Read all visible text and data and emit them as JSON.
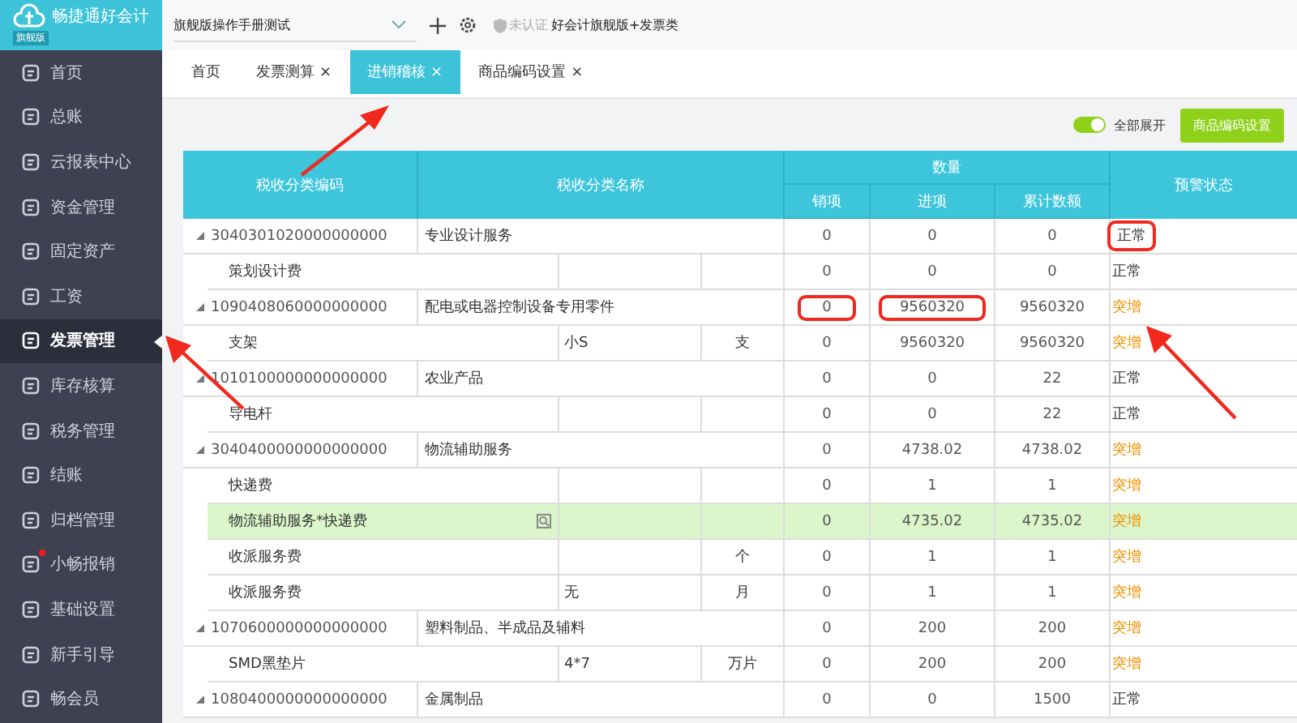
{
  "logo": {
    "name": "畅捷通好会计",
    "edition": "旗舰版"
  },
  "topbar": {
    "company": "旗舰版操作手册测试",
    "auth": "未认证",
    "product": "好会计旗舰版+发票类"
  },
  "sidebar": {
    "items": [
      {
        "label": "首页",
        "selected": false,
        "dot": false
      },
      {
        "label": "总账",
        "selected": false,
        "dot": false
      },
      {
        "label": "云报表中心",
        "selected": false,
        "dot": false
      },
      {
        "label": "资金管理",
        "selected": false,
        "dot": false
      },
      {
        "label": "固定资产",
        "selected": false,
        "dot": false
      },
      {
        "label": "工资",
        "selected": false,
        "dot": false
      },
      {
        "label": "发票管理",
        "selected": true,
        "dot": false
      },
      {
        "label": "库存核算",
        "selected": false,
        "dot": false
      },
      {
        "label": "税务管理",
        "selected": false,
        "dot": false
      },
      {
        "label": "结账",
        "selected": false,
        "dot": false
      },
      {
        "label": "归档管理",
        "selected": false,
        "dot": false
      },
      {
        "label": "小畅报销",
        "selected": false,
        "dot": true
      },
      {
        "label": "基础设置",
        "selected": false,
        "dot": false
      },
      {
        "label": "新手引导",
        "selected": false,
        "dot": false
      },
      {
        "label": "畅会员",
        "selected": false,
        "dot": false
      }
    ]
  },
  "tabs": [
    {
      "label": "首页",
      "selected": false
    },
    {
      "label": "发票测算",
      "selected": false,
      "close": "×"
    },
    {
      "label": "进销稽核",
      "selected": true,
      "close": "×"
    },
    {
      "label": "商品编码设置",
      "selected": false,
      "close": "×"
    }
  ],
  "toolbar": {
    "toggle": {
      "label": "全部展开",
      "on": true
    },
    "button": "商品编码设置"
  },
  "table": {
    "columns": {
      "code": "税收分类编码",
      "name": "税收分类名称",
      "quantity": "数量",
      "sales": "销项",
      "purchase": "进项",
      "total": "累计数额",
      "status": "预警状态"
    },
    "rows": [
      {
        "kind": "category",
        "code": "3040301020000000000",
        "name": "专业设计服务",
        "selected": false,
        "values": [
          {
            "v": "0",
            "boxed": false
          },
          {
            "v": "0",
            "boxed": false
          },
          {
            "v": "0",
            "boxed": false
          }
        ],
        "status": {
          "text": "正常",
          "alert": false,
          "boxed": true
        }
      },
      {
        "kind": "item",
        "name": "策划设计费",
        "spec": "",
        "unit": "",
        "selected": false,
        "values": [
          {
            "v": "0",
            "boxed": false
          },
          {
            "v": "0",
            "boxed": false
          },
          {
            "v": "0",
            "boxed": false
          }
        ],
        "status": {
          "text": "正常",
          "alert": false,
          "boxed": false
        }
      },
      {
        "kind": "category",
        "code": "1090408060000000000",
        "name": "配电或电器控制设备专用零件",
        "selected": false,
        "values": [
          {
            "v": "0",
            "boxed": true
          },
          {
            "v": "9560320",
            "boxed": true
          },
          {
            "v": "9560320",
            "boxed": false
          }
        ],
        "status": {
          "text": "突增",
          "alert": true,
          "boxed": false
        }
      },
      {
        "kind": "item",
        "name": "支架",
        "spec": "小S",
        "unit": "支",
        "selected": false,
        "values": [
          {
            "v": "0",
            "boxed": false
          },
          {
            "v": "9560320",
            "boxed": false
          },
          {
            "v": "9560320",
            "boxed": false
          }
        ],
        "status": {
          "text": "突增",
          "alert": true,
          "boxed": false
        }
      },
      {
        "kind": "category",
        "code": "1010100000000000000",
        "name": "农业产品",
        "selected": false,
        "values": [
          {
            "v": "0",
            "boxed": false
          },
          {
            "v": "0",
            "boxed": false
          },
          {
            "v": "22",
            "boxed": false
          }
        ],
        "status": {
          "text": "正常",
          "alert": false,
          "boxed": false
        }
      },
      {
        "kind": "item",
        "name": "导电杆",
        "spec": "",
        "unit": "",
        "selected": false,
        "values": [
          {
            "v": "0",
            "boxed": false
          },
          {
            "v": "0",
            "boxed": false
          },
          {
            "v": "22",
            "boxed": false
          }
        ],
        "status": {
          "text": "正常",
          "alert": false,
          "boxed": false
        }
      },
      {
        "kind": "category",
        "code": "3040400000000000000",
        "name": "物流辅助服务",
        "selected": false,
        "values": [
          {
            "v": "0",
            "boxed": false
          },
          {
            "v": "4738.02",
            "boxed": false
          },
          {
            "v": "4738.02",
            "boxed": false
          }
        ],
        "status": {
          "text": "突增",
          "alert": true,
          "boxed": false
        }
      },
      {
        "kind": "item",
        "name": "快递费",
        "spec": "",
        "unit": "",
        "selected": false,
        "values": [
          {
            "v": "0",
            "boxed": false
          },
          {
            "v": "1",
            "boxed": false
          },
          {
            "v": "1",
            "boxed": false
          }
        ],
        "status": {
          "text": "突增",
          "alert": true,
          "boxed": false
        }
      },
      {
        "kind": "item",
        "name": "物流辅助服务*快递费",
        "spec": "",
        "unit": "",
        "selected": true,
        "values": [
          {
            "v": "0",
            "boxed": false
          },
          {
            "v": "4735.02",
            "boxed": false
          },
          {
            "v": "4735.02",
            "boxed": false
          }
        ],
        "status": {
          "text": "突增",
          "alert": true,
          "boxed": false
        }
      },
      {
        "kind": "item",
        "name": "收派服务费",
        "spec": "",
        "unit": "个",
        "selected": false,
        "values": [
          {
            "v": "0",
            "boxed": false
          },
          {
            "v": "1",
            "boxed": false
          },
          {
            "v": "1",
            "boxed": false
          }
        ],
        "status": {
          "text": "突增",
          "alert": true,
          "boxed": false
        }
      },
      {
        "kind": "item",
        "name": "收派服务费",
        "spec": "无",
        "unit": "月",
        "selected": false,
        "values": [
          {
            "v": "0",
            "boxed": false
          },
          {
            "v": "1",
            "boxed": false
          },
          {
            "v": "1",
            "boxed": false
          }
        ],
        "status": {
          "text": "突增",
          "alert": true,
          "boxed": false
        }
      },
      {
        "kind": "category",
        "code": "1070600000000000000",
        "name": "塑料制品、半成品及辅料",
        "selected": false,
        "values": [
          {
            "v": "0",
            "boxed": false
          },
          {
            "v": "200",
            "boxed": false
          },
          {
            "v": "200",
            "boxed": false
          }
        ],
        "status": {
          "text": "突增",
          "alert": true,
          "boxed": false
        }
      },
      {
        "kind": "item",
        "name": "SMD黑垫片",
        "spec": "4*7",
        "unit": "万片",
        "selected": false,
        "values": [
          {
            "v": "0",
            "boxed": false
          },
          {
            "v": "200",
            "boxed": false
          },
          {
            "v": "200",
            "boxed": false
          }
        ],
        "status": {
          "text": "突增",
          "alert": true,
          "boxed": false
        }
      },
      {
        "kind": "category",
        "code": "1080400000000000000",
        "name": "金属制品",
        "selected": false,
        "values": [
          {
            "v": "0",
            "boxed": false
          },
          {
            "v": "0",
            "boxed": false
          },
          {
            "v": "1500",
            "boxed": false
          }
        ],
        "status": {
          "text": "正常",
          "alert": false,
          "boxed": false
        }
      }
    ]
  }
}
